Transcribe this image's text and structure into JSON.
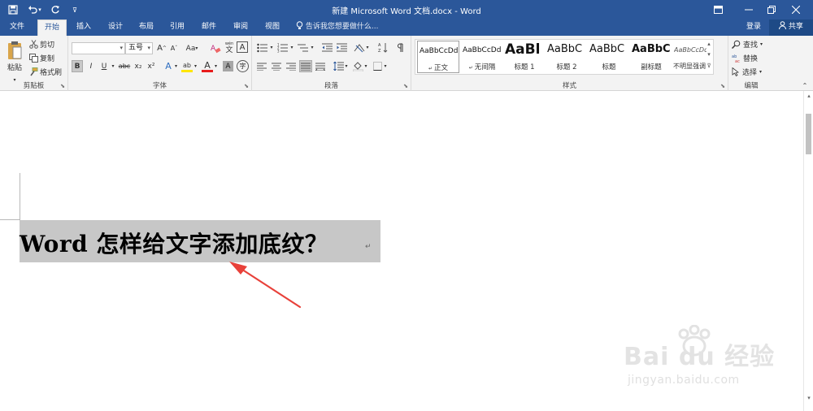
{
  "window": {
    "title": "新建 Microsoft Word 文档.docx - Word",
    "icons": [
      "save-icon",
      "undo-icon",
      "redo-icon",
      "customize-icon",
      "ribbon-display-icon",
      "minimize-icon",
      "restore-icon",
      "close-icon"
    ]
  },
  "tabs": [
    "文件",
    "开始",
    "插入",
    "设计",
    "布局",
    "引用",
    "邮件",
    "审阅",
    "视图"
  ],
  "active_tab": "开始",
  "tell_me": "告诉我您想要做什么...",
  "account": {
    "signin": "登录",
    "share": "共享"
  },
  "clipboard": {
    "paste": "粘贴",
    "cut": "剪切",
    "copy": "复制",
    "format_painter": "格式刷",
    "label": "剪贴板"
  },
  "font": {
    "font_name": "",
    "font_size": "五号",
    "grow": "A",
    "shrink": "A",
    "case": "Aa",
    "wen": "wén",
    "wen_char": "文",
    "border_char": "A",
    "bold": "B",
    "italic": "I",
    "underline": "U",
    "strike": "abc",
    "sub": "x₂",
    "sup": "x²",
    "effects": "A",
    "highlight": "ab",
    "font_color": "A",
    "shade_char": "A",
    "circle_char": "字",
    "label": "字体"
  },
  "paragraph": {
    "label": "段落"
  },
  "styles": {
    "label": "样式",
    "items": [
      {
        "preview": "AaBbCcDd",
        "name": "正文"
      },
      {
        "preview": "AaBbCcDd",
        "name": "无间隔"
      },
      {
        "preview": "AaBl",
        "name": "标题 1"
      },
      {
        "preview": "AaBbC",
        "name": "标题 2"
      },
      {
        "preview": "AaBbC",
        "name": "标题"
      },
      {
        "preview": "AaBbC",
        "name": "副标题"
      },
      {
        "preview": "AaBbCcDd",
        "name": "不明显强调"
      }
    ]
  },
  "editing": {
    "find": "查找",
    "replace": "替换",
    "select": "选择",
    "label": "编辑"
  },
  "document": {
    "heading": "Word 怎样给文字添加底纹？",
    "paragraph_mark": "↵"
  },
  "watermark": {
    "text": "Bai du 经验",
    "sub": "jingyan.baidu.com"
  },
  "colors": {
    "accent": "#2b579a",
    "shading": "#c7c7c7",
    "arrow": "#e8413a"
  }
}
